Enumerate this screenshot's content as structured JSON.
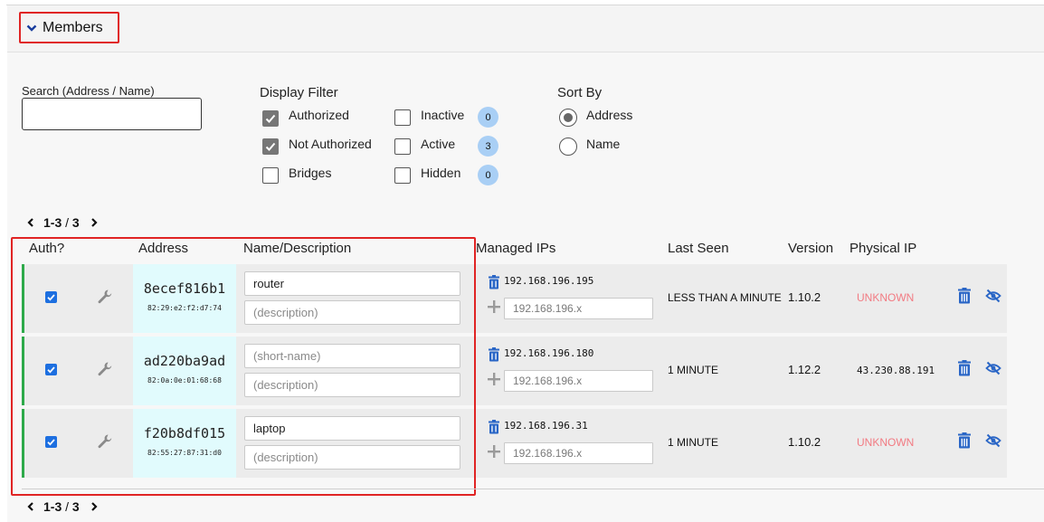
{
  "header": {
    "toggle_label": "Members"
  },
  "search": {
    "label": "Search (Address / Name)",
    "value": "",
    "placeholder": ""
  },
  "display_filter": {
    "title": "Display Filter",
    "options": [
      {
        "label": "Authorized",
        "checked": true
      },
      {
        "label": "Not Authorized",
        "checked": true
      },
      {
        "label": "Bridges",
        "checked": false
      },
      {
        "label": "Inactive",
        "checked": false,
        "count": "0"
      },
      {
        "label": "Active",
        "checked": false,
        "count": "3"
      },
      {
        "label": "Hidden",
        "checked": false,
        "count": "0"
      }
    ]
  },
  "sort_by": {
    "title": "Sort By",
    "options": [
      {
        "label": "Address",
        "selected": true
      },
      {
        "label": "Name",
        "selected": false
      }
    ]
  },
  "pager": {
    "range": "1-3",
    "sep": " / ",
    "total": "3"
  },
  "columns": {
    "auth": "Auth?",
    "address": "Address",
    "name": "Name/Description",
    "managed_ips": "Managed IPs",
    "last_seen": "Last Seen",
    "version": "Version",
    "physical_ip": "Physical IP"
  },
  "members": [
    {
      "authorized": true,
      "address": "8ecef816b1",
      "mac": "82:29:e2:f2:d7:74",
      "name": "router",
      "name_placeholder": "(short-name)",
      "description": "",
      "description_placeholder": "(description)",
      "managed_ip": "192.168.196.195",
      "ip_placeholder": "192.168.196.x",
      "last_seen": "LESS THAN A MINUTE",
      "version": "1.10.2",
      "physical_ip": "UNKNOWN"
    },
    {
      "authorized": true,
      "address": "ad220ba9ad",
      "mac": "82:0a:0e:01:68:68",
      "name": "",
      "name_placeholder": "(short-name)",
      "description": "",
      "description_placeholder": "(description)",
      "managed_ip": "192.168.196.180",
      "ip_placeholder": "192.168.196.x",
      "last_seen": "1 MINUTE",
      "version": "1.12.2",
      "physical_ip": "43.230.88.191"
    },
    {
      "authorized": true,
      "address": "f20b8df015",
      "mac": "82:55:27:87:31:d0",
      "name": "laptop",
      "name_placeholder": "(short-name)",
      "description": "",
      "description_placeholder": "(description)",
      "managed_ip": "192.168.196.31",
      "ip_placeholder": "192.168.196.x",
      "last_seen": "1 MINUTE",
      "version": "1.10.2",
      "physical_ip": "UNKNOWN"
    }
  ],
  "colors": {
    "accent_blue": "#1d6fe0",
    "icon_blue": "#2a66c6",
    "authorized_green": "#2eaa4a",
    "unknown_red": "#f27a82",
    "badge_blue": "#a9cff5",
    "address_bg": "#e1fbfd",
    "highlight_red": "#e02424"
  }
}
